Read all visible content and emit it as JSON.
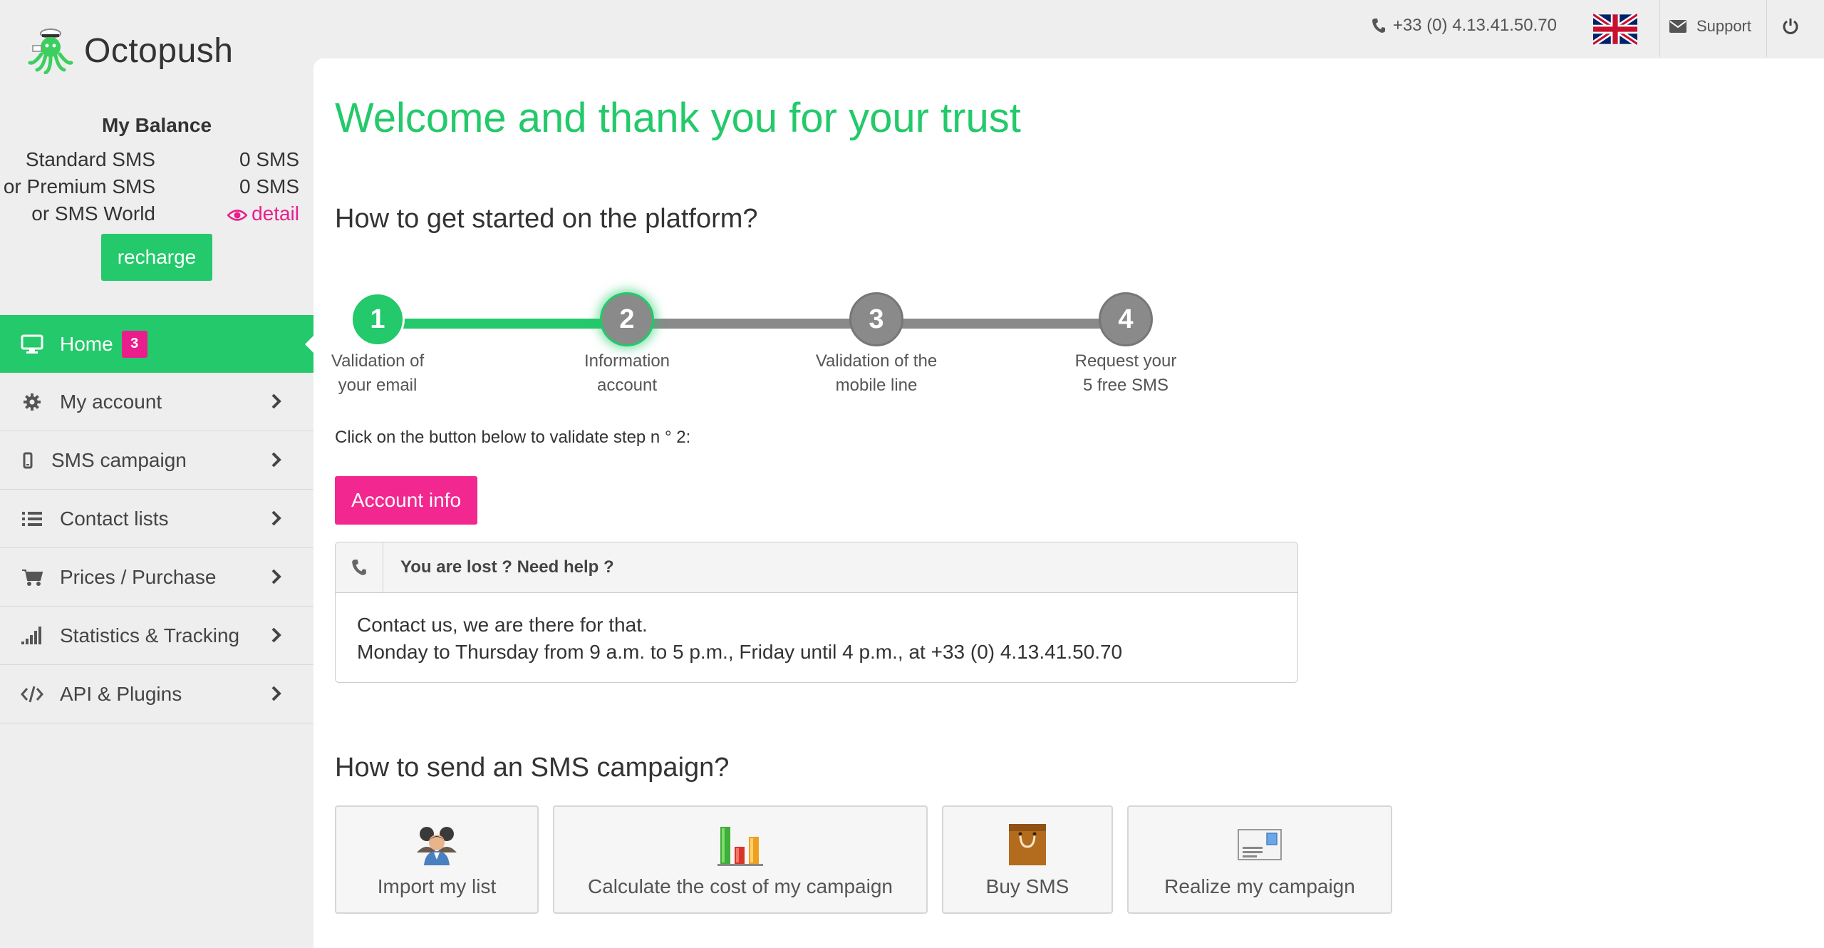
{
  "brand": {
    "name": "Octopush"
  },
  "balance": {
    "title": "My Balance",
    "rows": [
      {
        "label": "Standard SMS",
        "value": "0 SMS"
      },
      {
        "label": "or Premium SMS",
        "value": "0 SMS"
      },
      {
        "label": "or SMS World",
        "value": "detail"
      }
    ],
    "recharge_label": "recharge"
  },
  "nav": [
    {
      "label": "Home",
      "badge": "3",
      "icon": "monitor-icon",
      "active": true
    },
    {
      "label": "My account",
      "icon": "gear-icon"
    },
    {
      "label": "SMS campaign",
      "icon": "mobile-icon"
    },
    {
      "label": "Contact lists",
      "icon": "list-icon"
    },
    {
      "label": "Prices / Purchase",
      "icon": "cart-icon"
    },
    {
      "label": "Statistics & Tracking",
      "icon": "signal-bars-icon"
    },
    {
      "label": "API & Plugins",
      "icon": "code-icon"
    }
  ],
  "topbar": {
    "phone": "+33 (0) 4.13.41.50.70",
    "support_label": "Support",
    "language_flag": "uk-flag-icon"
  },
  "main": {
    "welcome": "Welcome and thank you for your trust",
    "getting_started_title": "How to get started on the platform?",
    "steps": [
      {
        "number": "1",
        "line1": "Validation of",
        "line2": "your email",
        "state": "done"
      },
      {
        "number": "2",
        "line1": "Information",
        "line2": "account",
        "state": "current"
      },
      {
        "number": "3",
        "line1": "Validation of the",
        "line2": "mobile line",
        "state": "todo"
      },
      {
        "number": "4",
        "line1": "Request your",
        "line2": "5 free SMS",
        "state": "todo"
      }
    ],
    "validate_text": "Click on the button below to validate step n ° 2:",
    "account_info_label": "Account info",
    "help": {
      "title": "You are lost ? Need help ?",
      "line1": "Contact us, we are there for that.",
      "line2": "Monday to Thursday from 9 a.m. to 5 p.m., Friday until 4 p.m., at +33 (0) 4.13.41.50.70"
    },
    "campaign_title": "How to send an SMS campaign?",
    "campaign_cards": [
      {
        "label": "Import my list",
        "icon": "people-icon"
      },
      {
        "label": "Calculate the cost of my campaign",
        "icon": "bar-chart-icon"
      },
      {
        "label": "Buy SMS",
        "icon": "shopping-bag-icon"
      },
      {
        "label": "Realize my campaign",
        "icon": "postcard-icon"
      }
    ]
  },
  "colors": {
    "green": "#23c96a",
    "pink": "#e91e8c",
    "gray_step": "#8a8a8a"
  }
}
